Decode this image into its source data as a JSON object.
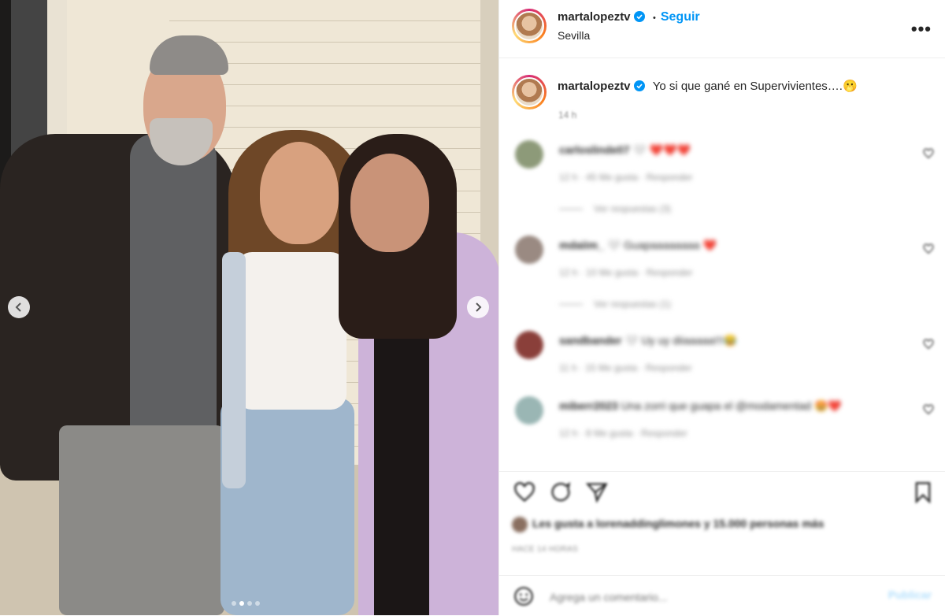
{
  "post": {
    "username": "martalopeztv",
    "follow_label": "Seguir",
    "separator": "•",
    "location": "Sevilla",
    "more_label": "•••",
    "caption_text": "Yo si que gané en Supervivientes….",
    "caption_emoji": "🫢",
    "caption_time": "14 h",
    "carousel": {
      "total": 4,
      "active_index": 1
    }
  },
  "comments": [
    {
      "user": "carloslinde07",
      "text": "🤍 ❤️❤️❤️",
      "meta": "12 h · 45 Me gusta · Responder",
      "replies": "Ver respuestas (3)"
    },
    {
      "user": "mdaiim_",
      "text": "🤍 Guapaaaaaaaa ❤️",
      "meta": "12 h · 10 Me gusta · Responder",
      "replies": "Ver respuestas (1)"
    },
    {
      "user": "sandbander",
      "text": "🤍 Uy uy diiaaaaa!!!😂",
      "meta": "11 h · 15 Me gusta · Responder",
      "replies": ""
    },
    {
      "user": "miberr2023",
      "text": "Una zorri que guapa el @modamentad 🤩❤️",
      "meta": "12 h · 8 Me gusta · Responder",
      "replies": ""
    }
  ],
  "likes_text": "Les gusta a lorenaddinglimones y 15.000 personas más",
  "date_text": "HACE 14 HORAS",
  "add_comment": {
    "placeholder": "Agrega un comentario...",
    "post_label": "Publicar"
  },
  "icons": [
    "heart-icon",
    "comment-icon",
    "share-icon",
    "bookmark-icon",
    "emoji-icon",
    "more-icon",
    "verified-icon",
    "chevron-left-icon",
    "chevron-right-icon"
  ],
  "colors": {
    "accent": "#0095f6",
    "verified": "#0095f6",
    "text": "#262626",
    "muted": "#8e8e8e"
  }
}
